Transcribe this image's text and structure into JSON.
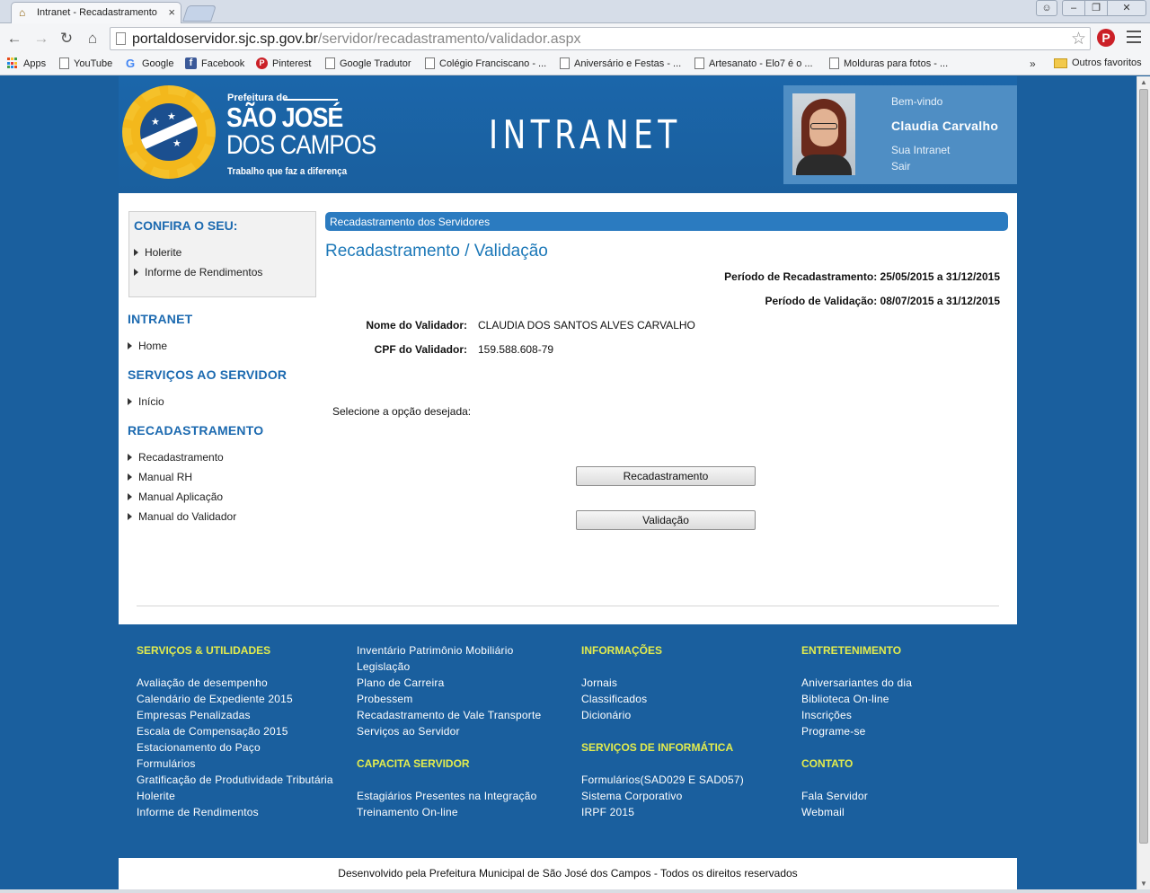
{
  "browser": {
    "tab_title": "Intranet - Recadastramento",
    "url_domain": "portaldoservidor.sjc.sp.gov.br",
    "url_path": "/servidor/recadastramento/validador.aspx",
    "bookmarks": [
      "Apps",
      "YouTube",
      "Google",
      "Facebook",
      "Pinterest",
      "Google Tradutor",
      "Colégio Franciscano - ...",
      "Aniversário e Festas - ...",
      "Artesanato - Elo7 é o ...",
      "Molduras para fotos - ..."
    ],
    "bookmarks_more": "»",
    "other_bookmarks": "Outros favoritos"
  },
  "header": {
    "logo_prefeitura": "Prefeitura de",
    "logo_city_line1": "SÃO JOSÉ",
    "logo_city_line2": "DOS CAMPOS",
    "logo_tagline": "Trabalho que faz a diferença",
    "title": "INTRANET",
    "welcome": "Bem-vindo",
    "user_name": "Claudia Carvalho",
    "link_intranet": "Sua Intranet",
    "link_logout": "Sair"
  },
  "sidebar": {
    "confira_title": "CONFIRA O SEU:",
    "confira_items": [
      "Holerite",
      "Informe de Rendimentos"
    ],
    "sections": [
      {
        "title": "INTRANET",
        "items": [
          "Home"
        ]
      },
      {
        "title": "SERVIÇOS AO SERVIDOR",
        "items": [
          "Início"
        ]
      },
      {
        "title": "RECADASTRAMENTO",
        "items": [
          "Recadastramento",
          "Manual RH",
          "Manual Aplicação",
          "Manual do Validador"
        ]
      }
    ]
  },
  "main": {
    "section_bar": "Recadastramento dos Servidores",
    "title": "Recadastramento / Validação",
    "period_recad": "Período de Recadastramento: 25/05/2015 a 31/12/2015",
    "period_valid": "Período de Validação: 08/07/2015 a 31/12/2015",
    "validator_name_label": "Nome do Validador:",
    "validator_name": "CLAUDIA DOS SANTOS ALVES CARVALHO",
    "validator_cpf_label": "CPF do Validador:",
    "validator_cpf": "159.588.608-79",
    "select_prompt": "Selecione a opção desejada:",
    "button_recad": "Recadastramento",
    "button_valid": "Validação"
  },
  "footer": {
    "col1": {
      "title": "SERVIÇOS & UTILIDADES",
      "items": [
        "Avaliação de desempenho",
        "Calendário de Expediente 2015",
        "Empresas Penalizadas",
        "Escala de Compensação 2015",
        "Estacionamento do Paço",
        "Formulários",
        "Gratificação de Produtividade Tributária",
        "Holerite",
        "Informe de Rendimentos"
      ]
    },
    "col2": {
      "items": [
        "Inventário Patrimônio Mobiliário",
        "Legislação",
        "Plano de Carreira",
        "Probessem",
        "Recadastramento de Vale Transporte",
        "Serviços ao Servidor"
      ],
      "title2": "CAPACITA SERVIDOR",
      "items2": [
        "Estagiários Presentes na Integração",
        "Treinamento On-line"
      ]
    },
    "col3": {
      "title": "INFORMAÇÕES",
      "items": [
        "Jornais",
        "Classificados",
        "Dicionário"
      ],
      "title2": "SERVIÇOS DE INFORMÁTICA",
      "items2": [
        "Formulários(SAD029 E SAD057)",
        "Sistema Corporativo",
        "IRPF 2015"
      ]
    },
    "col4": {
      "title": "ENTRETENIMENTO",
      "items": [
        "Aniversariantes do dia",
        "Biblioteca On-line",
        "Inscrições",
        "Programe-se"
      ],
      "title2": "CONTATO",
      "items2": [
        "Fala Servidor",
        "Webmail"
      ]
    },
    "copyright": "Desenvolvido pela Prefeitura Municipal de São José dos Campos - Todos os direitos reservados"
  },
  "colors": {
    "header_blue": "#1a5f9e",
    "link_blue": "#1c6ab0",
    "footer_heading": "#e3ec4d"
  }
}
